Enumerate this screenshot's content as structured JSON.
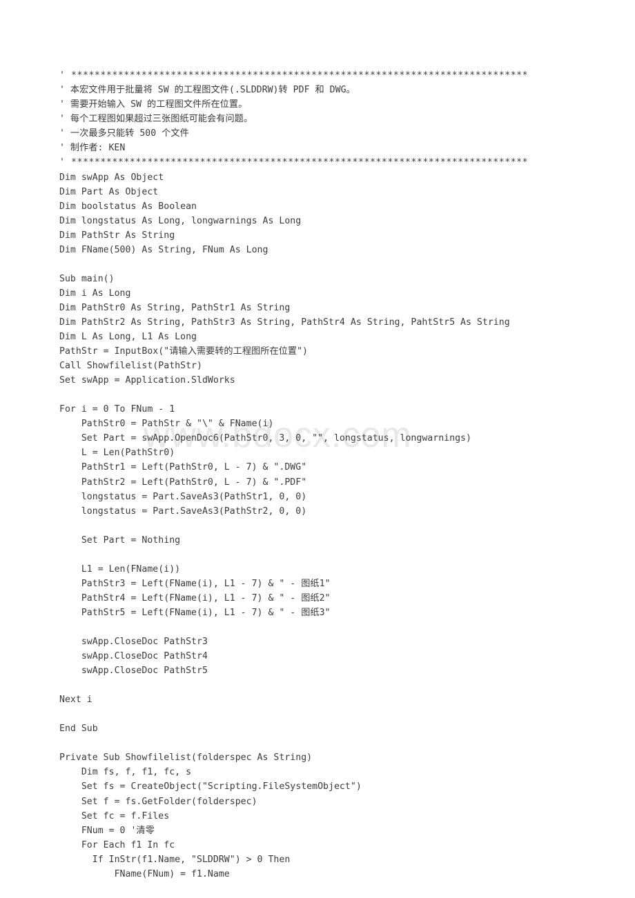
{
  "document": {
    "kind": "source-code-listing",
    "language": "VBA",
    "text_color": "#3a3a3a",
    "background_color": "#ffffff"
  },
  "watermark": {
    "text": "www.bdocx.com",
    "color": "#e8e8ea"
  },
  "code": {
    "lines": [
      "' ******************************************************************************",
      "' 本宏文件用于批量将 SW 的工程图文件(.SLDDRW)转 PDF 和 DWG。",
      "' 需要开始输入 SW 的工程图文件所在位置。",
      "' 每个工程图如果超过三张图纸可能会有问题。",
      "' 一次最多只能转 500 个文件",
      "' 制作者: KEN",
      "' ******************************************************************************",
      "Dim swApp As Object",
      "Dim Part As Object",
      "Dim boolstatus As Boolean",
      "Dim longstatus As Long, longwarnings As Long",
      "Dim PathStr As String",
      "Dim FName(500) As String, FNum As Long",
      "",
      "Sub main()",
      "Dim i As Long",
      "Dim PathStr0 As String, PathStr1 As String",
      "Dim PathStr2 As String, PathStr3 As String, PathStr4 As String, PahtStr5 As String",
      "Dim L As Long, L1 As Long",
      "PathStr = InputBox(\"请输入需要转的工程图所在位置\")",
      "Call Showfilelist(PathStr)",
      "Set swApp = Application.SldWorks",
      "",
      "For i = 0 To FNum - 1",
      "    PathStr0 = PathStr & \"\\\" & FName(i)",
      "    Set Part = swApp.OpenDoc6(PathStr0, 3, 0, \"\", longstatus, longwarnings)",
      "    L = Len(PathStr0)",
      "    PathStr1 = Left(PathStr0, L - 7) & \".DWG\"",
      "    PathStr2 = Left(PathStr0, L - 7) & \".PDF\"",
      "    longstatus = Part.SaveAs3(PathStr1, 0, 0)",
      "    longstatus = Part.SaveAs3(PathStr2, 0, 0)",
      "",
      "    Set Part = Nothing",
      "",
      "    L1 = Len(FName(i))",
      "    PathStr3 = Left(FName(i), L1 - 7) & \" - 图纸1\"",
      "    PathStr4 = Left(FName(i), L1 - 7) & \" - 图纸2\"",
      "    PathStr5 = Left(FName(i), L1 - 7) & \" - 图纸3\"",
      "",
      "    swApp.CloseDoc PathStr3",
      "    swApp.CloseDoc PathStr4",
      "    swApp.CloseDoc PathStr5",
      "",
      "Next i",
      "",
      "End Sub",
      "",
      "Private Sub Showfilelist(folderspec As String)",
      "    Dim fs, f, f1, fc, s",
      "    Set fs = CreateObject(\"Scripting.FileSystemObject\")",
      "    Set f = fs.GetFolder(folderspec)",
      "    Set fc = f.Files",
      "    FNum = 0 '清零",
      "    For Each f1 In fc",
      "      If InStr(f1.Name, \"SLDDRW\") > 0 Then",
      "          FName(FNum) = f1.Name"
    ],
    "line_flags": [
      "stars",
      "cjk",
      "cjk",
      "cjk",
      "cjk",
      "cjk",
      "stars",
      "",
      "",
      "",
      "",
      "",
      "",
      "blank",
      "",
      "",
      "",
      "wrap",
      "",
      "cjk",
      "",
      "",
      "blank",
      "",
      "",
      "",
      "",
      "",
      "",
      "",
      "",
      "blank",
      "",
      "blank",
      "",
      "cjk",
      "cjk",
      "cjk",
      "blank",
      "",
      "",
      "",
      "blank",
      "",
      "blank",
      "",
      "blank",
      "",
      "",
      "",
      "",
      "",
      "cjk",
      "",
      "",
      ""
    ]
  }
}
